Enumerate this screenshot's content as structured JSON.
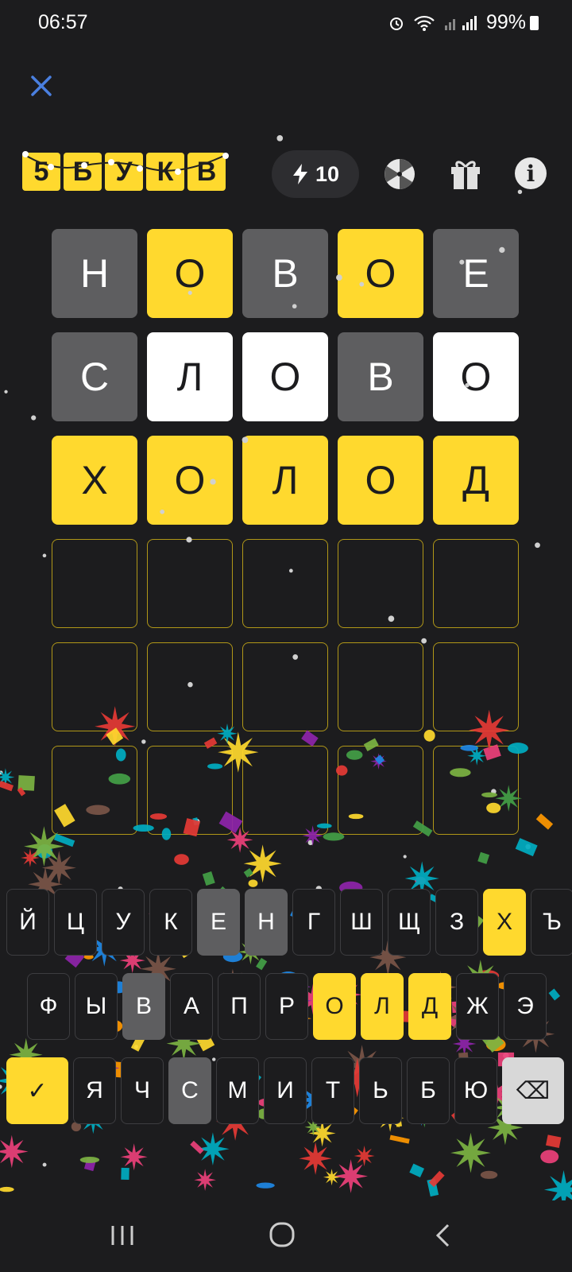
{
  "status": {
    "time": "06:57",
    "battery": "99%"
  },
  "header": {
    "logo_letters": [
      "5",
      "Б",
      "У",
      "К",
      "В"
    ],
    "energy_count": "10",
    "info_symbol": "i"
  },
  "board": {
    "rows": [
      [
        {
          "letter": "Н",
          "state": "gray"
        },
        {
          "letter": "О",
          "state": "yellow"
        },
        {
          "letter": "В",
          "state": "gray"
        },
        {
          "letter": "О",
          "state": "yellow"
        },
        {
          "letter": "Е",
          "state": "gray"
        }
      ],
      [
        {
          "letter": "С",
          "state": "gray"
        },
        {
          "letter": "Л",
          "state": "white"
        },
        {
          "letter": "О",
          "state": "white"
        },
        {
          "letter": "В",
          "state": "gray"
        },
        {
          "letter": "О",
          "state": "white"
        }
      ],
      [
        {
          "letter": "Х",
          "state": "yellow"
        },
        {
          "letter": "О",
          "state": "yellow"
        },
        {
          "letter": "Л",
          "state": "yellow"
        },
        {
          "letter": "О",
          "state": "yellow"
        },
        {
          "letter": "Д",
          "state": "yellow"
        }
      ],
      [
        {
          "letter": "",
          "state": "empty"
        },
        {
          "letter": "",
          "state": "empty"
        },
        {
          "letter": "",
          "state": "empty"
        },
        {
          "letter": "",
          "state": "empty"
        },
        {
          "letter": "",
          "state": "empty"
        }
      ],
      [
        {
          "letter": "",
          "state": "empty"
        },
        {
          "letter": "",
          "state": "empty"
        },
        {
          "letter": "",
          "state": "empty"
        },
        {
          "letter": "",
          "state": "empty"
        },
        {
          "letter": "",
          "state": "empty"
        }
      ],
      [
        {
          "letter": "",
          "state": "empty"
        },
        {
          "letter": "",
          "state": "empty"
        },
        {
          "letter": "",
          "state": "empty"
        },
        {
          "letter": "",
          "state": "empty"
        },
        {
          "letter": "",
          "state": "empty"
        }
      ]
    ]
  },
  "keyboard": {
    "row1": [
      {
        "k": "Й",
        "s": ""
      },
      {
        "k": "Ц",
        "s": ""
      },
      {
        "k": "У",
        "s": ""
      },
      {
        "k": "К",
        "s": ""
      },
      {
        "k": "Е",
        "s": "gray"
      },
      {
        "k": "Н",
        "s": "gray"
      },
      {
        "k": "Г",
        "s": ""
      },
      {
        "k": "Ш",
        "s": ""
      },
      {
        "k": "Щ",
        "s": ""
      },
      {
        "k": "З",
        "s": ""
      },
      {
        "k": "Х",
        "s": "yellow"
      },
      {
        "k": "Ъ",
        "s": ""
      }
    ],
    "row2": [
      {
        "k": "Ф",
        "s": ""
      },
      {
        "k": "Ы",
        "s": ""
      },
      {
        "k": "В",
        "s": "gray"
      },
      {
        "k": "А",
        "s": ""
      },
      {
        "k": "П",
        "s": ""
      },
      {
        "k": "Р",
        "s": ""
      },
      {
        "k": "О",
        "s": "yellow"
      },
      {
        "k": "Л",
        "s": "yellow"
      },
      {
        "k": "Д",
        "s": "yellow"
      },
      {
        "k": "Ж",
        "s": ""
      },
      {
        "k": "Э",
        "s": ""
      }
    ],
    "row3": [
      {
        "k": "Я",
        "s": ""
      },
      {
        "k": "Ч",
        "s": ""
      },
      {
        "k": "С",
        "s": "gray"
      },
      {
        "k": "М",
        "s": ""
      },
      {
        "k": "И",
        "s": ""
      },
      {
        "k": "Т",
        "s": ""
      },
      {
        "k": "Ь",
        "s": ""
      },
      {
        "k": "Б",
        "s": ""
      },
      {
        "k": "Ю",
        "s": ""
      }
    ],
    "enter_symbol": "✓",
    "backspace_symbol": "⌫"
  },
  "colors": {
    "yellow": "#ffd92e",
    "gray": "#5e5e60",
    "background": "#1c1c1e"
  }
}
